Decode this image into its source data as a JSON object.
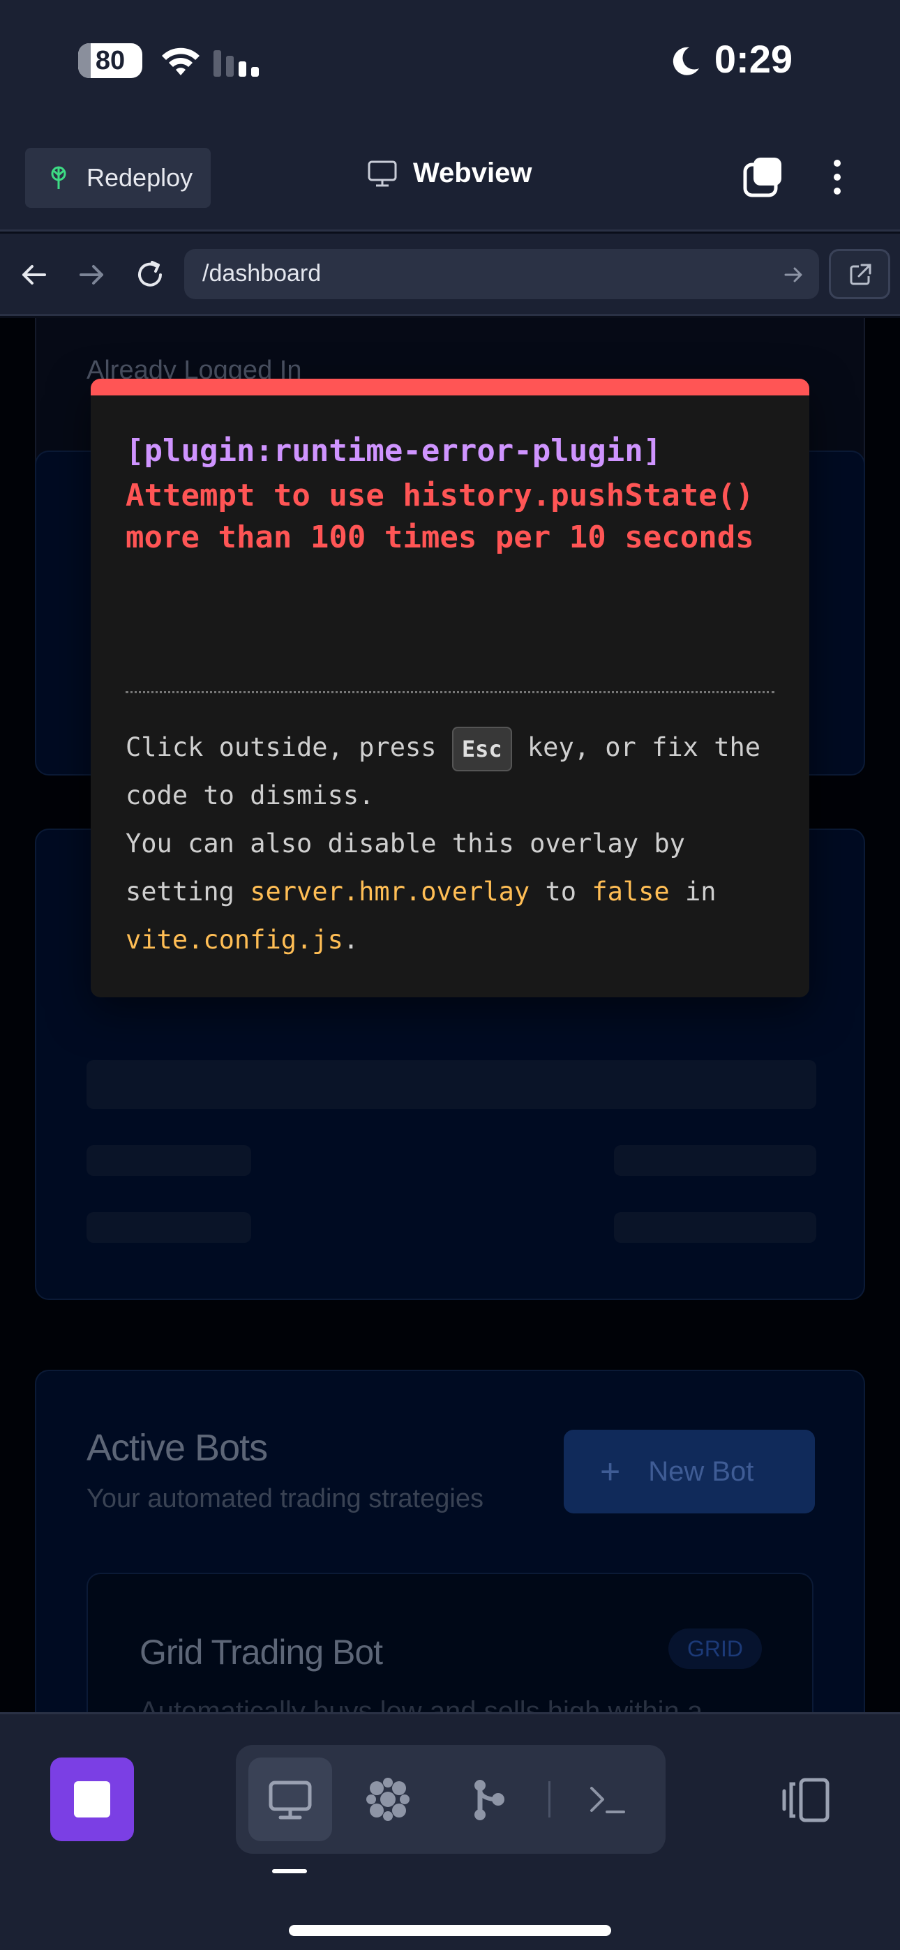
{
  "status_bar": {
    "battery": "80",
    "time": "0:29"
  },
  "app_bar": {
    "redeploy_label": "Redeploy",
    "title": "Webview"
  },
  "url_bar": {
    "url": "/dashboard"
  },
  "page": {
    "login_card_title": "Already Logged In",
    "active_bots": {
      "title": "Active Bots",
      "subtitle": "Your automated trading strategies",
      "new_bot_label": "New Bot"
    },
    "bot_card": {
      "name": "Grid Trading Bot",
      "badge": "GRID",
      "description": "Automatically buys low and sells high within a"
    }
  },
  "error_overlay": {
    "plugin": "[plugin:runtime-error-plugin]",
    "message": "Attempt to use history.pushState() more than 100 times per 10 seconds",
    "tip_prefix": "Click outside, press",
    "tip_key": "Esc",
    "tip_middle": "key, or fix the code to dismiss.",
    "tip_line2": "You can also disable this overlay by setting",
    "tip_setting": "server.hmr.overlay",
    "tip_to": "to",
    "tip_value": "false",
    "tip_in": "in",
    "tip_file": "vite.config.js",
    "tip_end": "."
  },
  "bottom_bar": {
    "tabs": [
      "webview",
      "extensions",
      "git",
      "terminal"
    ],
    "active_tab": "webview"
  },
  "colors": {
    "accent_purple": "#7b3fe4",
    "error_red": "#ff5555",
    "plugin_purple": "#cf94ff",
    "highlight_orange": "#ffbe55"
  }
}
